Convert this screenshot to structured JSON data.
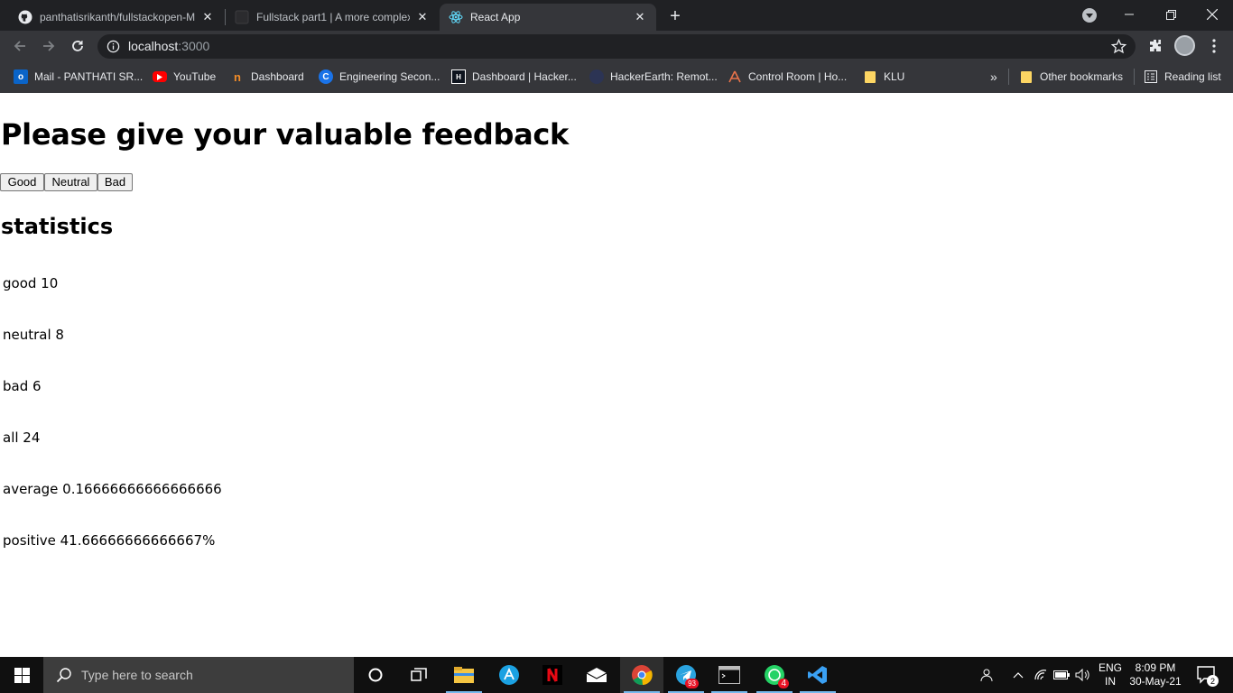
{
  "browser": {
    "tabs": [
      {
        "title": "panthatisrikanth/fullstackopen-M",
        "active": false
      },
      {
        "title": "Fullstack part1 | A more complex",
        "active": false
      },
      {
        "title": "React App",
        "active": true
      }
    ],
    "url_host": "localhost",
    "url_port": ":3000",
    "bookmarks": [
      {
        "label": "Mail - PANTHATI SR...",
        "icon": "outlook-icon"
      },
      {
        "label": "YouTube",
        "icon": "youtube-icon"
      },
      {
        "label": "Dashboard",
        "icon": "dashboard-icon"
      },
      {
        "label": "Engineering Secon...",
        "icon": "c-icon"
      },
      {
        "label": "Dashboard | Hacker...",
        "icon": "hackerrank-icon"
      },
      {
        "label": "HackerEarth: Remot...",
        "icon": "hackerearth-icon"
      },
      {
        "label": "Control Room | Ho...",
        "icon": "control-room-icon"
      },
      {
        "label": "KLU",
        "icon": "folder-icon"
      }
    ],
    "other_bookmarks": "Other bookmarks",
    "reading_list": "Reading list"
  },
  "page": {
    "heading": "Please give your valuable feedback",
    "buttons": {
      "good": "Good",
      "neutral": "Neutral",
      "bad": "Bad"
    },
    "stats_heading": "statistics",
    "stats": [
      "good 10",
      "neutral 8",
      "bad 6",
      "all 24",
      "average 0.16666666666666666",
      "positive 41.66666666666667%"
    ]
  },
  "taskbar": {
    "search_placeholder": "Type here to search",
    "telegram_badge": "93",
    "whatsapp_badge": "4",
    "language": "ENG",
    "region": "IN",
    "time": "8:09 PM",
    "date": "30-May-21",
    "notifications": "2"
  }
}
